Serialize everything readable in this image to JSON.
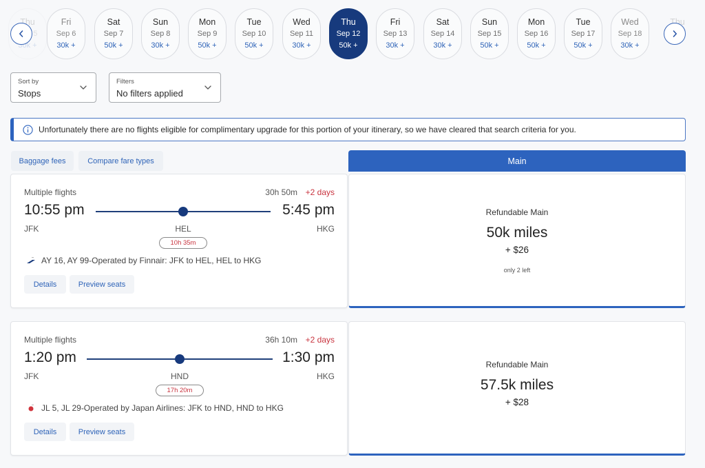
{
  "date_strip": {
    "prev_label": "Previous dates",
    "next_label": "Next dates",
    "dates": [
      {
        "dow": "Thu",
        "date": "Sep 5",
        "price": "30k +",
        "state": "ghost"
      },
      {
        "dow": "Fri",
        "date": "Sep 6",
        "price": "30k +",
        "state": "faded"
      },
      {
        "dow": "Sat",
        "date": "Sep 7",
        "price": "50k +",
        "state": "normal"
      },
      {
        "dow": "Sun",
        "date": "Sep 8",
        "price": "30k +",
        "state": "normal"
      },
      {
        "dow": "Mon",
        "date": "Sep 9",
        "price": "50k +",
        "state": "normal"
      },
      {
        "dow": "Tue",
        "date": "Sep 10",
        "price": "50k +",
        "state": "normal"
      },
      {
        "dow": "Wed",
        "date": "Sep 11",
        "price": "30k +",
        "state": "normal"
      },
      {
        "dow": "Thu",
        "date": "Sep 12",
        "price": "50k +",
        "state": "selected"
      },
      {
        "dow": "Fri",
        "date": "Sep 13",
        "price": "30k +",
        "state": "normal"
      },
      {
        "dow": "Sat",
        "date": "Sep 14",
        "price": "30k +",
        "state": "normal"
      },
      {
        "dow": "Sun",
        "date": "Sep 15",
        "price": "50k +",
        "state": "normal"
      },
      {
        "dow": "Mon",
        "date": "Sep 16",
        "price": "50k +",
        "state": "normal"
      },
      {
        "dow": "Tue",
        "date": "Sep 17",
        "price": "50k +",
        "state": "normal"
      },
      {
        "dow": "Wed",
        "date": "Sep 18",
        "price": "30k +",
        "state": "faded"
      },
      {
        "dow": "Thu",
        "date": "",
        "price": "",
        "state": "ghost"
      }
    ]
  },
  "sort": {
    "label": "Sort by",
    "value": "Stops"
  },
  "filters": {
    "label": "Filters",
    "value": "No filters applied"
  },
  "alert": {
    "icon": "info-icon",
    "message": "Unfortunately there are no flights eligible for complimentary upgrade for this portion of your itinerary, so we have cleared that search criteria for you."
  },
  "toolbar": {
    "baggage_fees": "Baggage fees",
    "compare_fare_types": "Compare fare types",
    "fare_column_header": "Main"
  },
  "colors": {
    "primary": "#2d63be",
    "selected_date": "#173a7d",
    "alert_red": "#c8333e"
  },
  "flights": [
    {
      "kind": "Multiple flights",
      "duration": "30h 50m",
      "plus_days": "+2 days",
      "depart_time": "10:55 pm",
      "arrive_time": "5:45 pm",
      "origin": "JFK",
      "stop": "HEL",
      "destination": "HKG",
      "layover": "10h 35m",
      "airline_icon": "finnair-logo-icon",
      "operated_by": "AY 16, AY 99-Operated by Finnair: JFK to HEL, HEL to HKG",
      "details_label": "Details",
      "preview_seats_label": "Preview seats",
      "fare": {
        "name": "Refundable Main",
        "miles": "50k miles",
        "fee": "+ $26",
        "seats_left": "only 2 left"
      }
    },
    {
      "kind": "Multiple flights",
      "duration": "36h 10m",
      "plus_days": "+2 days",
      "depart_time": "1:20 pm",
      "arrive_time": "1:30 pm",
      "origin": "JFK",
      "stop": "HND",
      "destination": "HKG",
      "layover": "17h 20m",
      "airline_icon": "japan-airlines-logo-icon",
      "operated_by": "JL 5, JL 29-Operated by Japan Airlines: JFK to HND, HND to HKG",
      "details_label": "Details",
      "preview_seats_label": "Preview seats",
      "fare": {
        "name": "Refundable Main",
        "miles": "57.5k miles",
        "fee": "+ $28",
        "seats_left": ""
      }
    }
  ]
}
